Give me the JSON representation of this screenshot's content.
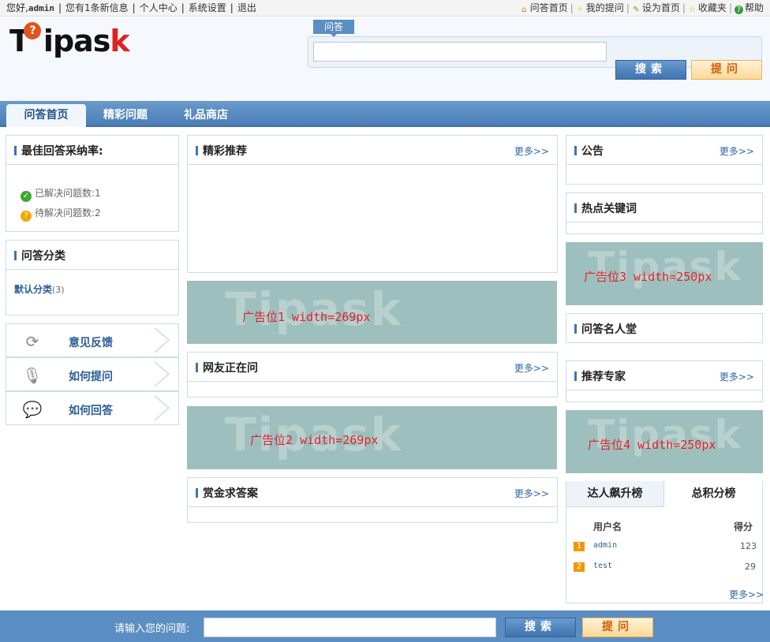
{
  "topbar": {
    "greeting": "您好,",
    "username": "admin",
    "messages": "您有1条新信息",
    "profile": "个人中心",
    "settings": "系统设置",
    "logout": "退出",
    "links": [
      {
        "label": "问答首页",
        "icon": "home-icon"
      },
      {
        "label": "我的提问",
        "icon": "bulb-icon"
      },
      {
        "label": "设为首页",
        "icon": "pencil-icon"
      },
      {
        "label": "收藏夹",
        "icon": "star-icon"
      },
      {
        "label": "帮助",
        "icon": "help-icon"
      }
    ]
  },
  "logo": {
    "text": "Tipask",
    "badge": "?"
  },
  "search": {
    "tab": "问答",
    "value": "",
    "search_label": "搜索",
    "ask_label": "提问"
  },
  "nav": {
    "items": [
      "问答首页",
      "精彩问题",
      "礼品商店"
    ],
    "active": 0
  },
  "left": {
    "rate_title": "最佳回答采纳率:",
    "solved": "已解决问题数:1",
    "pending": "待解决问题数:2",
    "category_title": "问答分类",
    "category_name": "默认分类",
    "category_count": "(3)",
    "help": [
      {
        "label": "意见反馈",
        "icon": "refresh-icon"
      },
      {
        "label": "如何提问",
        "icon": "microphone-icon"
      },
      {
        "label": "如何回答",
        "icon": "chat-icon"
      }
    ]
  },
  "center": {
    "featured_title": "精彩推荐",
    "ad1": "广告位1 width=269px",
    "asking_title": "网友正在问",
    "ad2": "广告位2 width=269px",
    "bounty_title": "赏金求答案",
    "more": "更多>>",
    "watermark": "Tipask"
  },
  "right": {
    "notice_title": "公告",
    "keywords_title": "热点关键词",
    "ad3": "广告位3 width=250px",
    "fame_title": "问答名人堂",
    "experts_title": "推荐专家",
    "ad4": "广告位4 width=250px",
    "rank_tabs": [
      "达人飙升榜",
      "总积分榜"
    ],
    "rank_active": 1,
    "rank_col_user": "用户名",
    "rank_col_score": "得分",
    "rank_rows": [
      {
        "rank": "1",
        "user": "admin",
        "score": "123"
      },
      {
        "rank": "2",
        "user": "test",
        "score": "29"
      }
    ],
    "more": "更多>>"
  },
  "footer": {
    "prompt": "请输入您的问题:",
    "value": "",
    "search_label": "搜索",
    "ask_label": "提问"
  },
  "colors": {
    "brand_blue": "#5b8ec3",
    "ad_bg": "#9dbfbd",
    "ad_text": "#e3222b",
    "orange": "#f39800"
  }
}
